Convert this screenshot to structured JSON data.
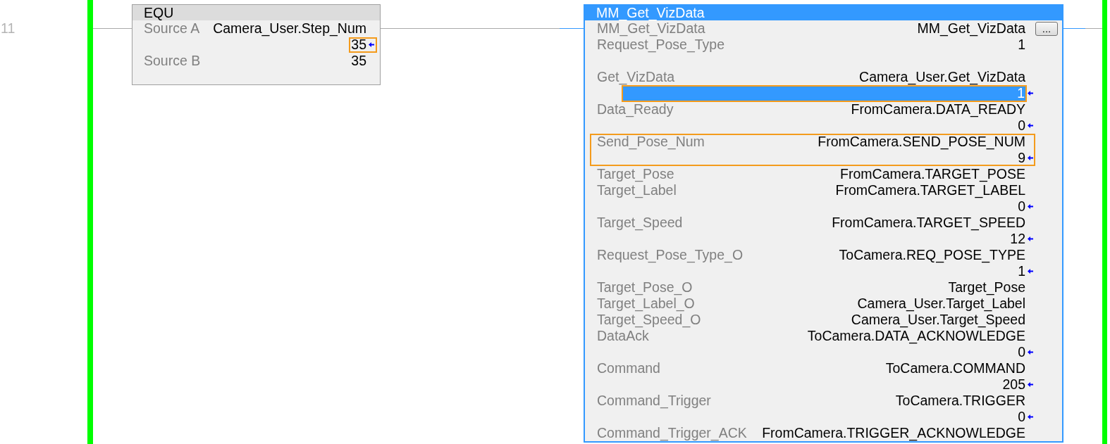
{
  "rung": {
    "number": "11"
  },
  "instructions": [
    {
      "kind": "compare",
      "title": "EQU",
      "selected": false,
      "parameter_groups": [
        [
          {
            "name": "Source A",
            "tag": "Camera_User.Step_Num",
            "highlighted": false,
            "value": {
              "text": "35",
              "selected": false,
              "highlighted": true
            }
          },
          {
            "name": "Source B",
            "tag": "35",
            "highlighted": false
          }
        ]
      ]
    },
    {
      "kind": "add_on",
      "title": "MM_Get_VizData",
      "selected": true,
      "parameter_groups": [
        [
          {
            "name": "MM_Get_VizData",
            "tag": "MM_Get_VizData",
            "highlighted": false,
            "button": "..."
          },
          {
            "name": "Request_Pose_Type",
            "tag": "1",
            "highlighted": false
          }
        ],
        [
          {
            "name": "Get_VizData",
            "tag": "Camera_User.Get_VizData",
            "highlighted": false,
            "value": {
              "text": "1",
              "selected": true,
              "highlighted": true
            }
          },
          {
            "name": "Data_Ready",
            "tag": "FromCamera.DATA_READY",
            "highlighted": false,
            "value": {
              "text": "0",
              "selected": false,
              "highlighted": false
            }
          },
          {
            "name": "Send_Pose_Num",
            "tag": "FromCamera.SEND_POSE_NUM",
            "highlighted": true,
            "value": {
              "text": "9",
              "selected": false,
              "highlighted": false
            }
          },
          {
            "name": "Target_Pose",
            "tag": "FromCamera.TARGET_POSE",
            "highlighted": false
          },
          {
            "name": "Target_Label",
            "tag": "FromCamera.TARGET_LABEL",
            "highlighted": false,
            "value": {
              "text": "0",
              "selected": false,
              "highlighted": false
            }
          },
          {
            "name": "Target_Speed",
            "tag": "FromCamera.TARGET_SPEED",
            "highlighted": false,
            "value": {
              "text": "12",
              "selected": false,
              "highlighted": false
            }
          },
          {
            "name": "Request_Pose_Type_O",
            "tag": "ToCamera.REQ_POSE_TYPE",
            "highlighted": false,
            "value": {
              "text": "1",
              "selected": false,
              "highlighted": false
            }
          },
          {
            "name": "Target_Pose_O",
            "tag": "Target_Pose",
            "highlighted": false
          },
          {
            "name": "Target_Label_O",
            "tag": "Camera_User.Target_Label",
            "highlighted": false
          },
          {
            "name": "Target_Speed_O",
            "tag": "Camera_User.Target_Speed",
            "highlighted": false
          },
          {
            "name": "DataAck",
            "tag": "ToCamera.DATA_ACKNOWLEDGE",
            "highlighted": false,
            "value": {
              "text": "0",
              "selected": false,
              "highlighted": false
            }
          },
          {
            "name": "Command",
            "tag": "ToCamera.COMMAND",
            "highlighted": false,
            "value": {
              "text": "205",
              "selected": false,
              "highlighted": false
            }
          },
          {
            "name": "Command_Trigger",
            "tag": "ToCamera.TRIGGER",
            "highlighted": false,
            "value": {
              "text": "0",
              "selected": false,
              "highlighted": false
            }
          },
          {
            "name": "Command_Trigger_ACK",
            "tag": "FromCamera.TRIGGER_ACKNOWLEDGE",
            "highlighted": false
          }
        ]
      ]
    }
  ]
}
